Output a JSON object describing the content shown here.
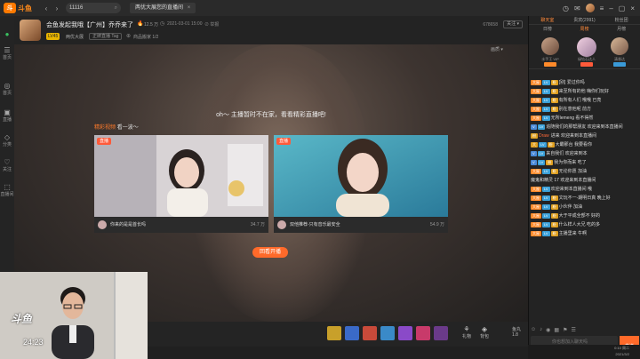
{
  "topbar": {
    "logo_badge": "斗",
    "logo_text": "斗鱼",
    "back_glyph": "‹",
    "forward_glyph": "›",
    "search_value": "11116",
    "tab_label": "两优大展您的直播间",
    "tab_close": "×",
    "icons": [
      "history-icon",
      "message-icon",
      "avatar",
      "minimize-icon",
      "maximize-icon",
      "close-icon"
    ]
  },
  "leftnav": {
    "items": [
      {
        "icon": "●",
        "label": ""
      },
      {
        "icon": "☰",
        "label": "首页"
      },
      {
        "icon": "◎",
        "label": "首页"
      },
      {
        "icon": "▣",
        "label": "直播"
      },
      {
        "icon": "◇",
        "label": "分类"
      },
      {
        "icon": "♡",
        "label": "关注"
      },
      {
        "icon": "⬚",
        "label": "直播间"
      }
    ]
  },
  "room": {
    "title": "会鱼发起我哦【广州】乔乔来了",
    "hot_icon": "🔥",
    "hot_value": "12.5 万",
    "clock_glyph": "◷",
    "timestamp": "2021-03-01 15:00",
    "report": "⊘ 举报",
    "level_badge": "LV45",
    "category": "两优大展",
    "tag": "正牌直播 Tag",
    "ext_icon": "⊕",
    "ext_label": "商品搬家 1/2",
    "room_id": "678658",
    "follow_btn": "关注 ▾"
  },
  "player": {
    "corner_text": "画质 ▾",
    "offline_message": "oh～ 主播暂时不在家，看看精彩直播吧!",
    "rec_label_a": "精彩视频",
    "rec_label_b": "看一波～",
    "cards": [
      {
        "badge": "直播",
        "title": "你来的是是首长吗",
        "count": "34.7 万"
      },
      {
        "badge": "直播",
        "title": "双他推荐-只有音乐最安全",
        "count": "54.9 万"
      }
    ],
    "recommend_button": "回看开播"
  },
  "bottombar": {
    "gift_colors": [
      "#c8a02a",
      "#3a6ac8",
      "#c84a3a",
      "#3a8ac8",
      "#8a4ac8",
      "#c83a6a",
      "#6a3a8a"
    ],
    "buttons": [
      {
        "icon": "⚘",
        "label": "礼物"
      },
      {
        "icon": "◈",
        "label": "背包"
      }
    ],
    "fish_label": "鱼丸",
    "fish_count": "1.8"
  },
  "webcam": {
    "logo": "斗鱼",
    "number": "24:23"
  },
  "rpanel": {
    "tabs": [
      "聊天室",
      "贵宾(2991)",
      "粉丝团"
    ],
    "subtabs": [
      "日榜",
      "周榜",
      "月榜"
    ],
    "ranks": [
      {
        "name": "水手王 VIP",
        "badge": "#ff8a2a"
      },
      {
        "name": "绿钻石达人",
        "badge": "#ff5a3a"
      },
      {
        "name": "清香达",
        "badge": "#3a9ad8"
      }
    ],
    "messages": [
      {
        "badges": [
          [
            "大屋",
            "#ff8a2a"
          ],
          [
            "LV",
            "#3aa0d8"
          ],
          [
            "粉",
            "#e0a020"
          ]
        ],
        "user": "",
        "text": "[别]  爱过你吗"
      },
      {
        "badges": [
          [
            "大屋",
            "#ff8a2a"
          ],
          [
            "LV",
            "#3aa0d8"
          ],
          [
            "粉",
            "#e0a020"
          ]
        ],
        "user": "",
        "text": "来至所有的他  嗨你们玩好"
      },
      {
        "badges": [
          [
            "大屋",
            "#ff8a2a"
          ],
          [
            "LV",
            "#3aa0d8"
          ],
          [
            "粉",
            "#e0a020"
          ]
        ],
        "user": "",
        "text": "有所有人们  哦哦 已亮"
      },
      {
        "badges": [
          [
            "大屋",
            "#ff8a2a"
          ],
          [
            "LV",
            "#3aa0d8"
          ],
          [
            "粉",
            "#e0a020"
          ]
        ],
        "user": "",
        "text": "别在意他呢  前方"
      },
      {
        "badges": [
          [
            "大屋",
            "#ff8a2a"
          ],
          [
            "LV",
            "#3aa0d8"
          ]
        ],
        "user": "",
        "text": "无所lemeng  看不得然"
      },
      {
        "badges": [
          [
            "V",
            "#4a8ad8"
          ],
          [
            "LV",
            "#3aa0d8"
          ]
        ],
        "user": "",
        "text": "追随我们的那帮朋友  欢迎来到本直播间"
      },
      {
        "badges": [
          [
            "粉",
            "#e0a020"
          ]
        ],
        "user": "Draw",
        "text": "进来  欢迎来到本直播间"
      },
      {
        "badges": [
          [
            "大",
            "#e0a020"
          ],
          [
            "LV",
            "#3aa0d8"
          ],
          [
            "粉",
            "#e0a020"
          ]
        ],
        "user": "",
        "text": "大霸那台  我要看你"
      },
      {
        "badges": [
          [
            "V",
            "#4a8ad8"
          ],
          [
            "LV",
            "#3aa0d8"
          ]
        ],
        "user": "",
        "text": "来自我们  欢迎来到本"
      },
      {
        "badges": [
          [
            "V",
            "#4a8ad8"
          ],
          [
            "LV",
            "#3aa0d8"
          ],
          [
            "粉",
            "#e0a020"
          ]
        ],
        "user": "",
        "text": "我为你而来  吃了"
      },
      {
        "badges": [
          [
            "大屋",
            "#ff8a2a"
          ],
          [
            "LV",
            "#3aa0d8"
          ],
          [
            "粉",
            "#e0a020"
          ]
        ],
        "user": "",
        "text": "无论你愿  加油"
      },
      {
        "badges": [],
        "user": "",
        "text": "魔鬼和精灵 17  欢迎来到本直播间"
      },
      {
        "badges": [
          [
            "大屋",
            "#ff8a2a"
          ],
          [
            "LV",
            "#3aa0d8"
          ]
        ],
        "user": "",
        "text": "欢迎来到本直播间 哦"
      },
      {
        "badges": [
          [
            "大屋",
            "#ff8a2a"
          ],
          [
            "LV",
            "#3aa0d8"
          ],
          [
            "粉",
            "#e0a020"
          ]
        ],
        "user": "",
        "text": "文玩不一-期明日真  晚上好"
      },
      {
        "badges": [
          [
            "大屋",
            "#ff8a2a"
          ],
          [
            "LV",
            "#3aa0d8"
          ],
          [
            "粉",
            "#e0a020"
          ]
        ],
        "user": "",
        "text": "小伙伴  加油"
      },
      {
        "badges": [
          [
            "大屋",
            "#ff8a2a"
          ],
          [
            "LV",
            "#3aa0d8"
          ],
          [
            "粉",
            "#e0a020"
          ]
        ],
        "user": "",
        "text": "大于平成全部不  好的"
      },
      {
        "badges": [
          [
            "大屋",
            "#ff8a2a"
          ],
          [
            "LV",
            "#3aa0d8"
          ],
          [
            "粉",
            "#e0a020"
          ]
        ],
        "user": "",
        "text": "什么样人大兄  吃的多"
      },
      {
        "badges": [
          [
            "大屋",
            "#ff8a2a"
          ],
          [
            "LV",
            "#3aa0d8"
          ],
          [
            "粉",
            "#e0a020"
          ]
        ],
        "user": "",
        "text": "主播里来  牛啊"
      }
    ],
    "chat_icons": [
      "☺",
      "♪",
      "◉",
      "▦",
      "⚑",
      "☰"
    ],
    "input_placeholder": "你也想加入聊天吗",
    "send_label": "发送",
    "time": "0:10 周二",
    "date": "2021/3/2"
  }
}
